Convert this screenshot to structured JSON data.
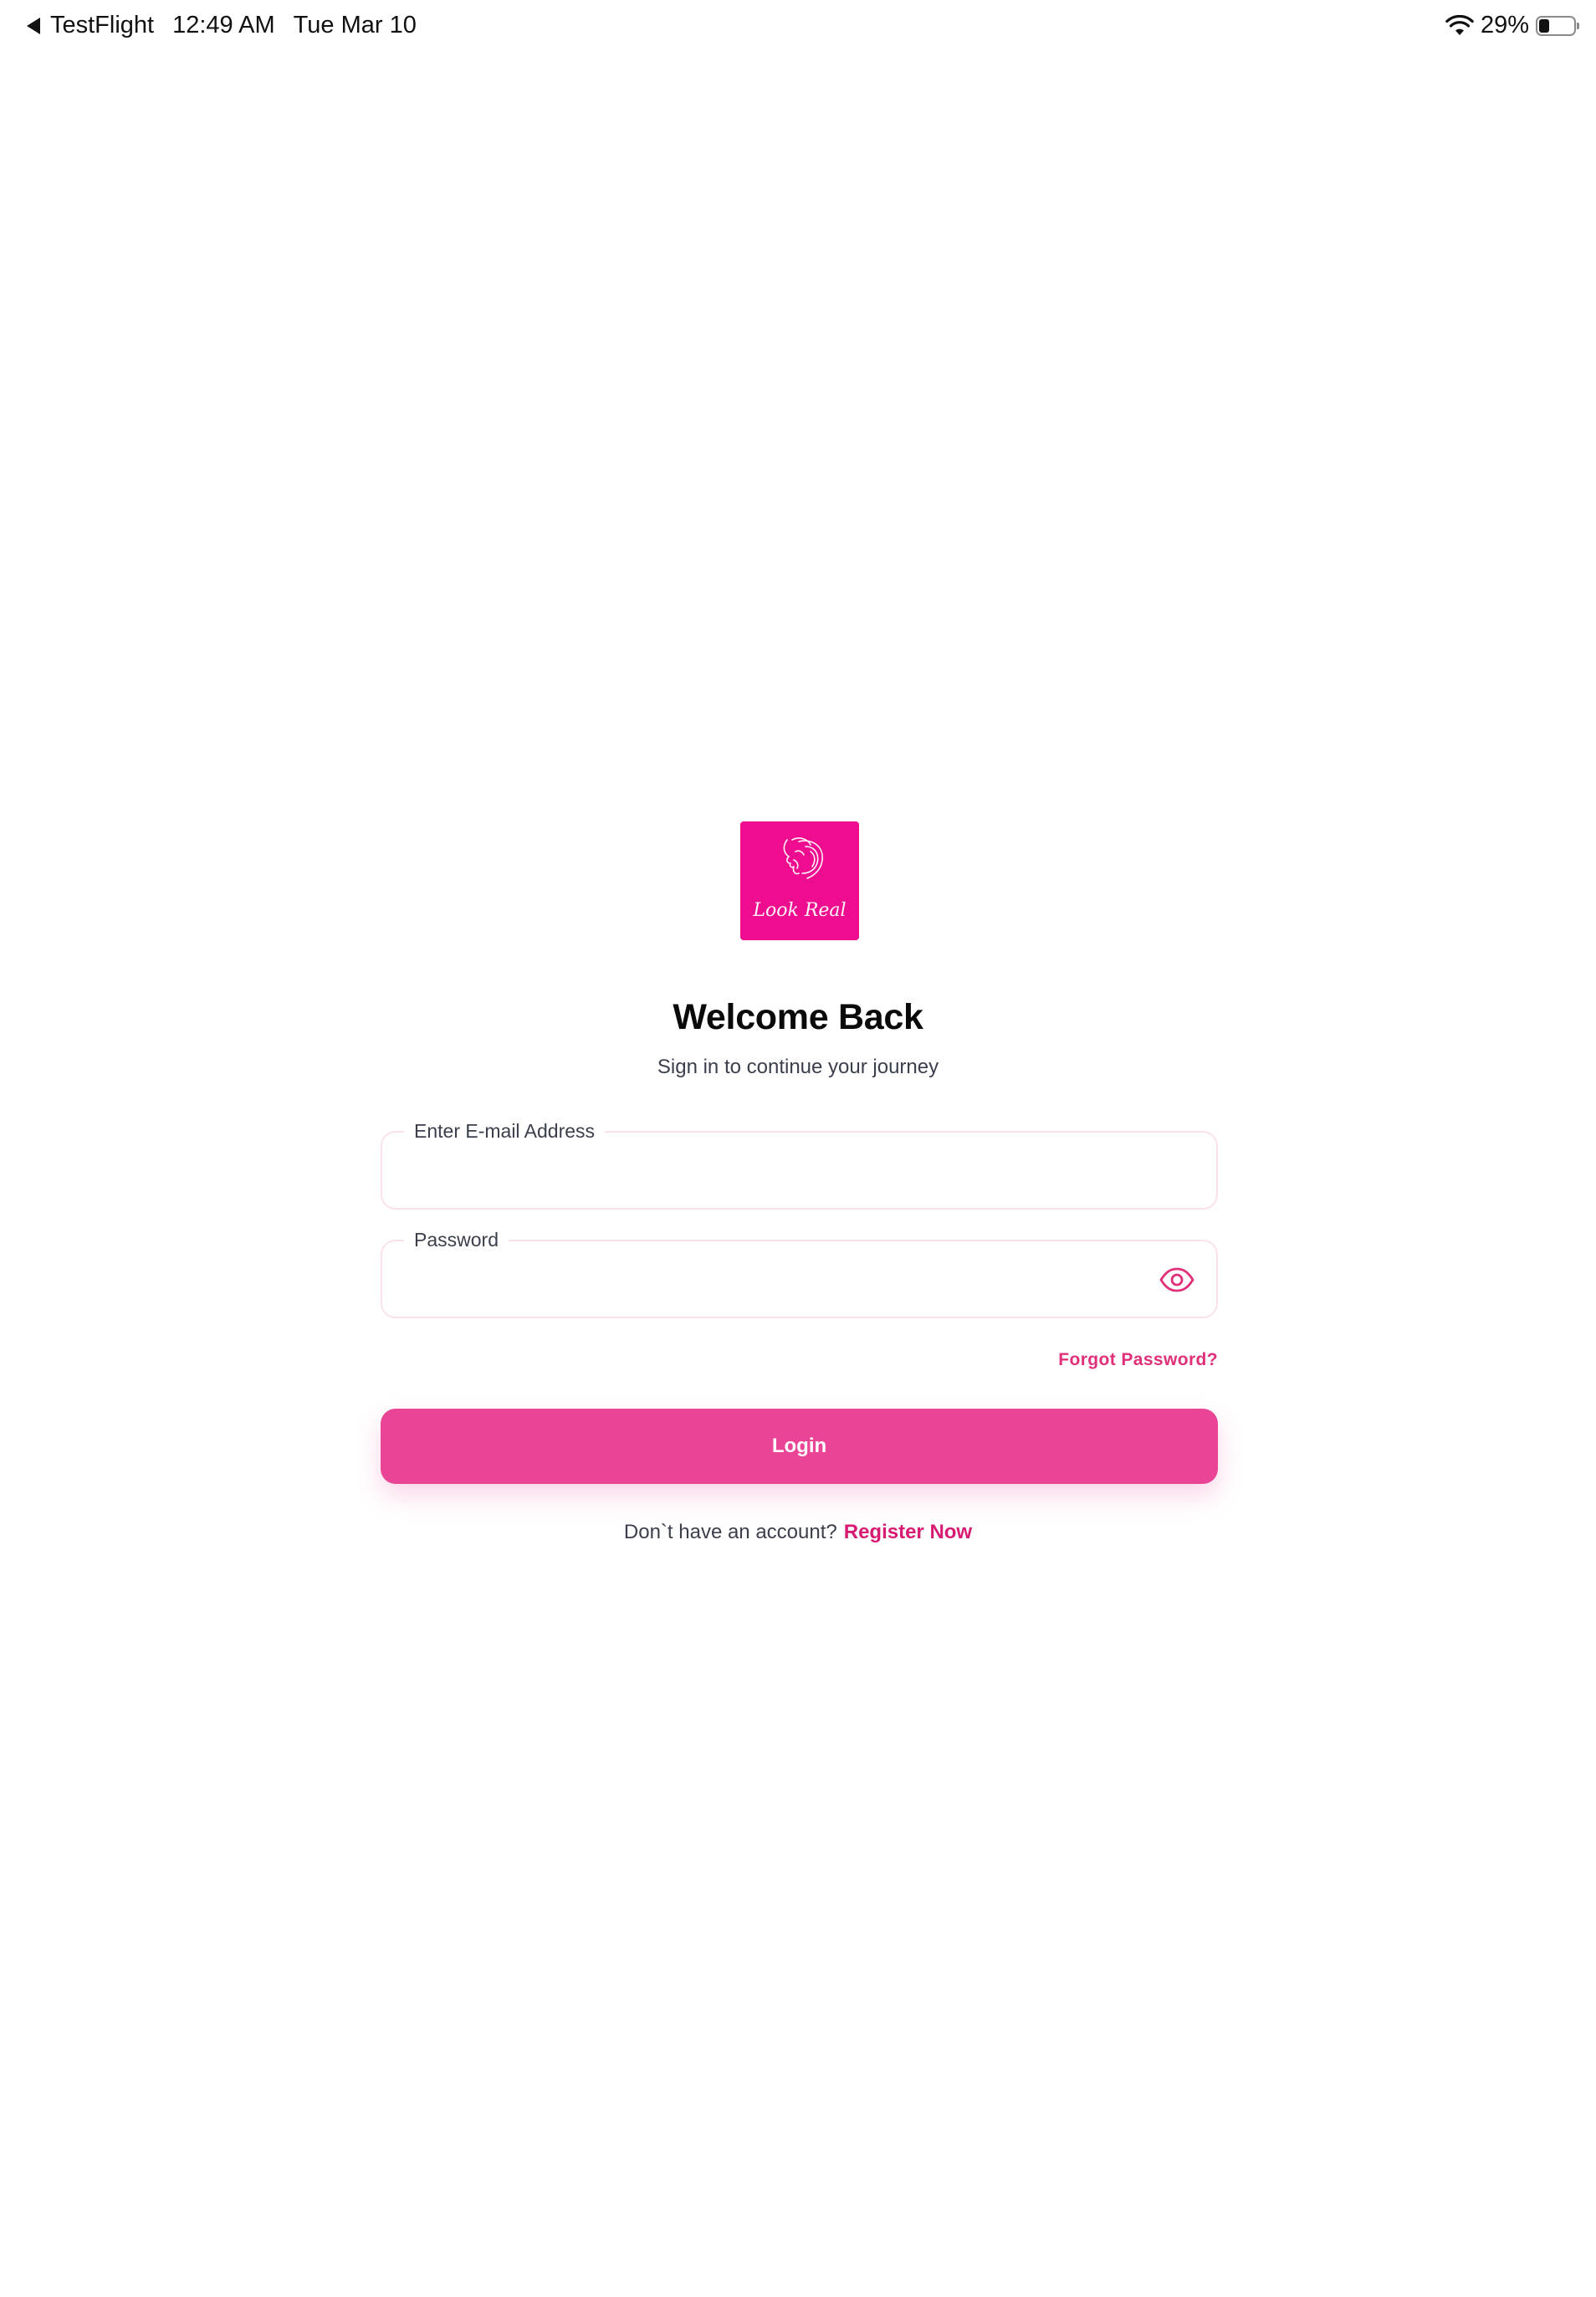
{
  "status_bar": {
    "back_app": "TestFlight",
    "time": "12:49 AM",
    "date": "Tue Mar 10",
    "battery_percent": "29%",
    "battery_level": 0.29,
    "icons": [
      "back-arrow-icon",
      "wifi-icon",
      "battery-icon"
    ]
  },
  "logo": {
    "text": "Look Real",
    "color": "#ee0d8f"
  },
  "login": {
    "title": "Welcome Back",
    "subtitle": "Sign in to continue your journey",
    "email_label": "Enter E-mail Address",
    "email_value": "",
    "password_label": "Password",
    "password_value": "",
    "forgot_label": "Forgot Password?",
    "login_label": "Login",
    "no_account_text": "Don`t have an account?",
    "register_label": "Register Now"
  },
  "colors": {
    "accent": "#ea4497",
    "link": "#d81b72",
    "field_border": "#fbe1ec"
  }
}
